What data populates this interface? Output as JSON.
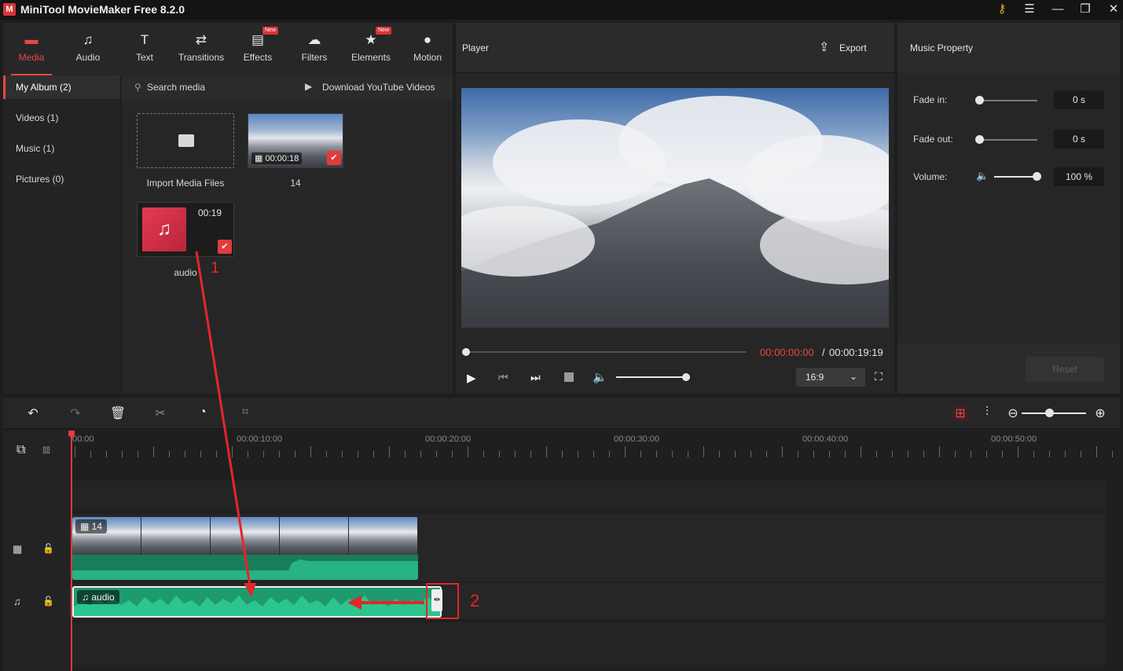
{
  "app": {
    "title": "MiniTool MovieMaker Free 8.2.0"
  },
  "toolbar": {
    "tabs": [
      {
        "label": "Media",
        "icon": "folder-icon",
        "active": true
      },
      {
        "label": "Audio",
        "icon": "music-note-icon"
      },
      {
        "label": "Text",
        "icon": "text-icon"
      },
      {
        "label": "Transitions",
        "icon": "transitions-icon"
      },
      {
        "label": "Effects",
        "icon": "effects-icon",
        "badge": "New"
      },
      {
        "label": "Filters",
        "icon": "filters-icon"
      },
      {
        "label": "Elements",
        "icon": "elements-icon",
        "badge": "New"
      },
      {
        "label": "Motion",
        "icon": "motion-icon"
      }
    ]
  },
  "sidebar": {
    "items": [
      {
        "label": "My Album (2)",
        "active": true
      },
      {
        "label": "Videos (1)"
      },
      {
        "label": "Music (1)"
      },
      {
        "label": "Pictures (0)"
      }
    ]
  },
  "media": {
    "search_placeholder": "Search media",
    "download_label": "Download YouTube Videos",
    "import_label": "Import Media Files",
    "video_item": {
      "name": "14",
      "duration": "00:00:18"
    },
    "audio_item": {
      "name": "audio",
      "duration": "00:19"
    }
  },
  "player": {
    "title": "Player",
    "export_label": "Export",
    "time_current": "00:00:00:00",
    "time_separator": "/",
    "time_total": "00:00:19:19",
    "aspect_ratio": "16:9",
    "volume_level": 0.95
  },
  "music_property": {
    "title": "Music Property",
    "fade_in_label": "Fade in:",
    "fade_in_value": "0 s",
    "fade_out_label": "Fade out:",
    "fade_out_value": "0 s",
    "volume_label": "Volume:",
    "volume_value": "100 %",
    "reset_label": "Reset"
  },
  "timeline": {
    "ruler_labels": [
      "00:00",
      "00:00:10:00",
      "00:00:20:00",
      "00:00:30:00",
      "00:00:40:00",
      "00:00:50:00"
    ],
    "video_clip_label": "14",
    "audio_clip_label": "audio"
  },
  "annotations": {
    "step1": "1",
    "step2": "2"
  },
  "colors": {
    "accent": "#e84747",
    "audio_green": "#1f9a6f",
    "annotation_red": "#e3262b"
  }
}
